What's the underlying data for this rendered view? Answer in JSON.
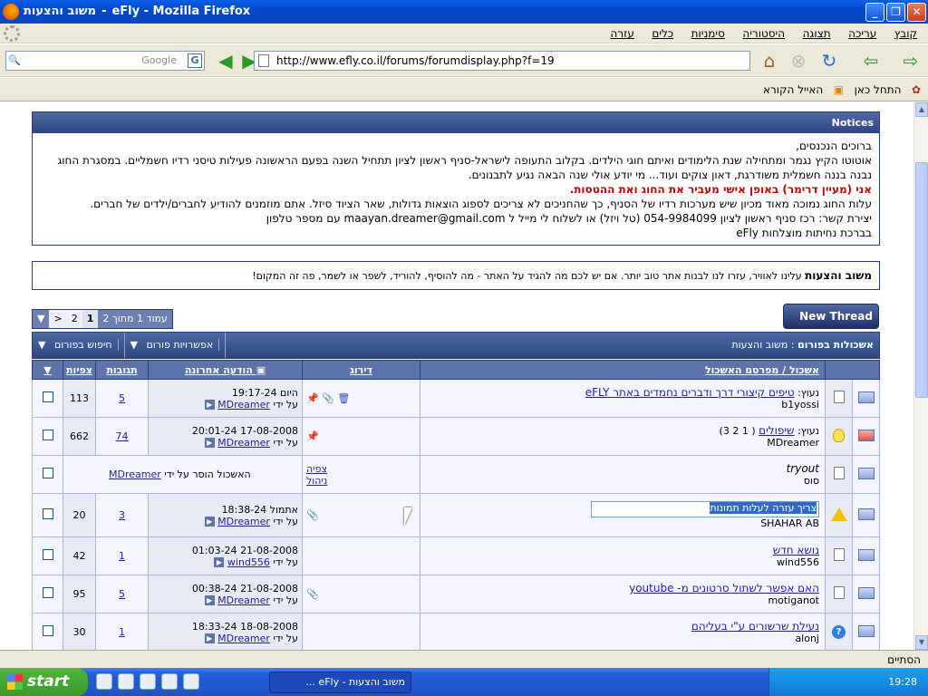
{
  "window": {
    "title": "משוב והצעות - eFly - Mozilla Firefox",
    "title_site": "eFly - Mozilla Firefox",
    "title_page": "משוב והצעות"
  },
  "menu": [
    "קובץ",
    "עריכה",
    "תצוגה",
    "היסטוריה",
    "סימניות",
    "כלים",
    "עזרה"
  ],
  "toolbar": {
    "url": "http://www.efly.co.il/forums/forumdisplay.php?f=19",
    "search_placeholder": "Google",
    "search_engine_icon": "G"
  },
  "bookmarks": [
    "התחל כאן",
    "האייל הקורא"
  ],
  "notices": {
    "header": "Notices",
    "lines": [
      "ברוכים הנכנסים,",
      "אוטוטו הקיץ נגמר ומתחילה שנת הלימודים ואיתם חוגי הילדים. בקלוב התעופה לישראל-סניף ראשון לציון תתחיל השנה בפעם הראשונה פעילות טיסני רדיו חשמליים. במסגרת החוג",
      "נבנה בננה חשמלית משודרגת, דאון צוקים ועוד... מי יודע אולי שנה הבאה נגיע לתבנונים.",
      "אני (מעיין דרימר) באופן אישי מעביר את החוג ואת ההטסות.",
      "עלות החוג נמוכה מאוד מכיון שיש מערכות רדיו של הסניף, כך שהחניכים לא צריכים לספוג הוצאות גדולות, שאר הציוד סיזל. אתם מוזמנים להודיע לחברים/ילדים של חברים.",
      "יצירת קשר: רכז סניף ראשון לציון 054-9984099 (טל ויזל) או לשלוח לי מייל ל maayan.dreamer@gmail.com עם מספר טלפון",
      "בברכת נחיתות מוצלחות eFly"
    ]
  },
  "forum_header": {
    "name": "משוב והצעות",
    "description": "עלינו לאוויר, עזרו לנו לבנות אתר טוב יותר. אם יש לכם מה להגיד על האתר - מה להוסיף, להוריד, לשפר או לשמר, פה זה המקום!"
  },
  "pager": {
    "label": "עמוד 1 מתוך 2",
    "pages": [
      "1",
      "2"
    ],
    "next": ">"
  },
  "new_thread_label": "New Thread",
  "thread_header": {
    "title": "אשכולות בפורום",
    "forum": "משוב והצעות",
    "options": "אפשרויות פורום",
    "search": "חיפוש בפורום"
  },
  "columns": {
    "thread": "אשכול",
    "starter": "מפרסם האשכול",
    "rating": "דירוג",
    "last_post": "הודעה אחרונה",
    "replies": "תגובות",
    "views": "צפיות"
  },
  "threads": [
    {
      "prefix": "נעוץ:",
      "title": "טיפים קיצורי דרך ודברים נחמדים באתר eFLY",
      "author": "b1yossi",
      "date": "היום",
      "time": "19:17-24",
      "by": "על ידי",
      "last_user": "MDreamer",
      "replies": "5",
      "views": "113",
      "icon": "envelope",
      "rating": "📌 📎 🗑"
    },
    {
      "prefix": "נעוץ:",
      "title": "שיפולים",
      "pages": "( 1 2 3)",
      "author": "MDreamer",
      "date": "17-08-2008",
      "time": "20:01-24",
      "by": "על ידי",
      "last_user": "MDreamer",
      "replies": "74",
      "views": "662",
      "icon": "bulb",
      "rating": "📌"
    },
    {
      "title": "tryout",
      "author": "סוס",
      "moved_text": "האשכול הוסר על ידי",
      "moved_user": "MDreamer",
      "actions": [
        "צפיה",
        "ניהול"
      ],
      "icon": "envelope"
    },
    {
      "title": "צריך עזרה לעלות תמונות",
      "author": "SHAHAR AB",
      "date": "אתמול",
      "time": "18:38-24",
      "by": "על ידי",
      "last_user": "MDreamer",
      "replies": "3",
      "views": "20",
      "icon": "warning",
      "rating": "📎"
    },
    {
      "title": "נושא חדש",
      "author": "wind556",
      "date": "21-08-2008",
      "time": "01:03-24",
      "by": "על ידי",
      "last_user": "wind556",
      "replies": "1",
      "views": "42",
      "icon": "envelope",
      "rating": ""
    },
    {
      "title": "האם אפשר לשתול סרטונים מ- youtube",
      "author": "motiganot",
      "date": "21-08-2008",
      "time": "00:38-24",
      "by": "על ידי",
      "last_user": "MDreamer",
      "replies": "5",
      "views": "95",
      "icon": "envelope",
      "rating": "📎"
    },
    {
      "title": "נעילת שרשורים ע\"י בעליהם",
      "author": "alonj",
      "date": "18-08-2008",
      "time": "18:33-24",
      "by": "על ידי",
      "last_user": "MDreamer",
      "replies": "1",
      "views": "30",
      "icon": "question",
      "rating": ""
    }
  ],
  "status": "הסתיים",
  "taskbar": {
    "start": "start",
    "task": "משוב והצעות - eFly ...",
    "clock": "19:28"
  }
}
